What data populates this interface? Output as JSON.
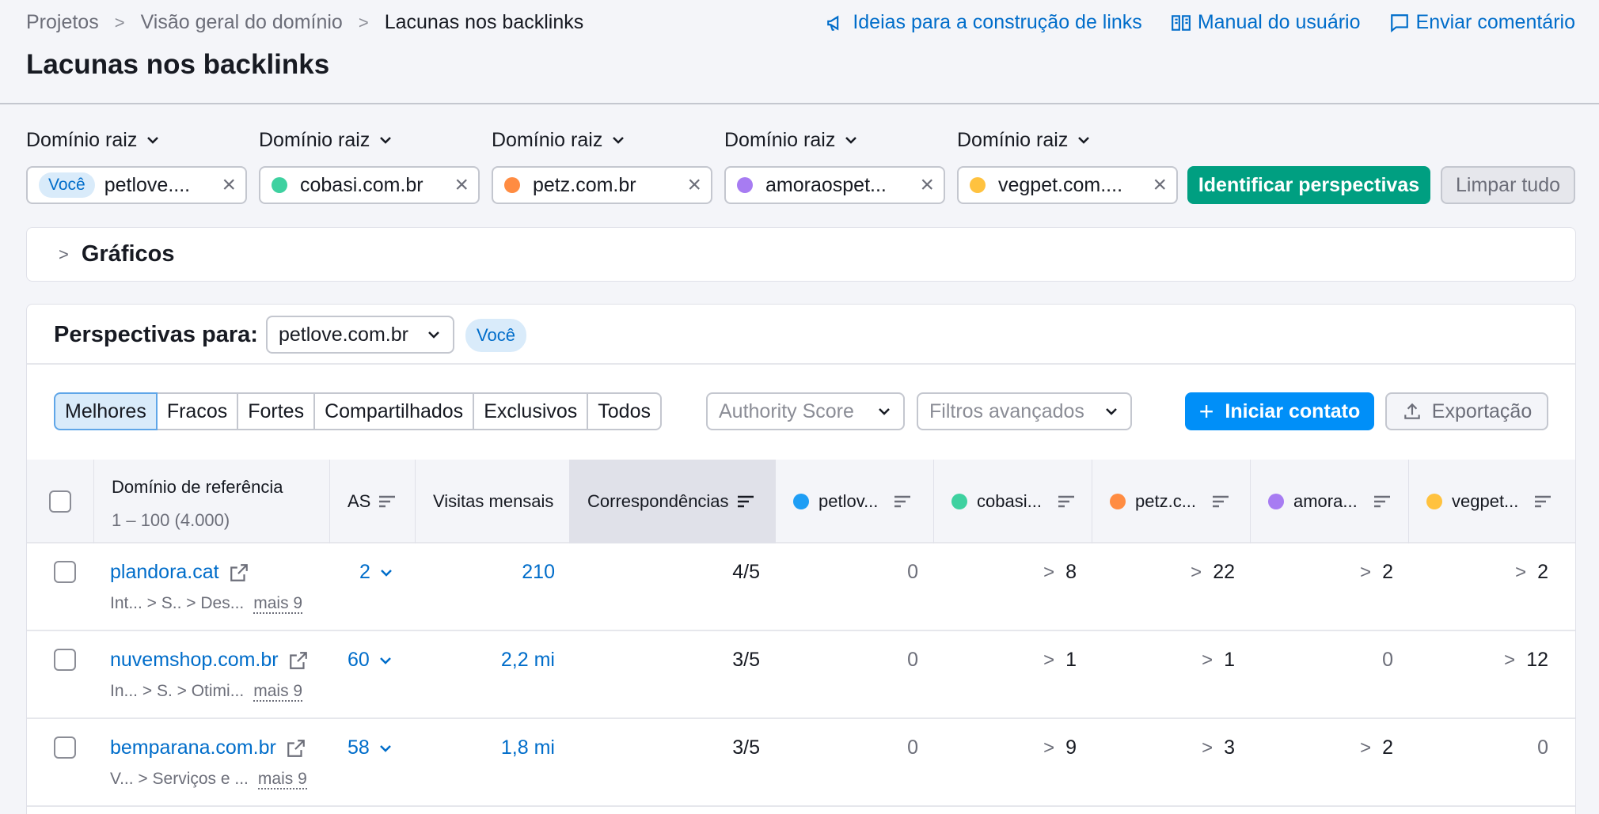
{
  "breadcrumb": [
    "Projetos",
    "Visão geral do domínio",
    "Lacunas nos backlinks"
  ],
  "top_links": [
    {
      "label": "Ideias para a construção de links",
      "icon": "megaphone-icon"
    },
    {
      "label": "Manual do usuário",
      "icon": "book-icon"
    },
    {
      "label": "Enviar comentário",
      "icon": "comment-icon"
    }
  ],
  "page_title": "Lacunas nos backlinks",
  "domain_label": "Domínio raiz",
  "domains": [
    {
      "value": "petlove....",
      "you": "Você",
      "color": ""
    },
    {
      "value": "cobasi.com.br",
      "color": "#3ed1a0"
    },
    {
      "value": "petz.com.br",
      "color": "#ff8c42"
    },
    {
      "value": "amoraospet...",
      "color": "#a77cf2"
    },
    {
      "value": "vegpet.com....",
      "color": "#ffc23f"
    }
  ],
  "identify_button": "Identificar perspectivas",
  "clear_button": "Limpar tudo",
  "charts_label": "Gráficos",
  "perspectives": {
    "label": "Perspectivas para:",
    "selected": "petlove.com.br",
    "badge": "Você"
  },
  "tabs": [
    "Melhores",
    "Fracos",
    "Fortes",
    "Compartilhados",
    "Exclusivos",
    "Todos"
  ],
  "filters": {
    "authority": "Authority Score",
    "advanced": "Filtros avançados"
  },
  "contact_button": "Iniciar contato",
  "export_button": "Exportação",
  "table": {
    "headers": {
      "domain": "Domínio de referência",
      "range": "1 – 100 (4.000)",
      "as": "AS",
      "visits": "Visitas mensais",
      "matches": "Correspondências",
      "cols": [
        {
          "label": "petlov...",
          "color": "#1e9ef5"
        },
        {
          "label": "cobasi...",
          "color": "#3ed1a0"
        },
        {
          "label": "petz.c...",
          "color": "#ff8c42"
        },
        {
          "label": "amora...",
          "color": "#a77cf2"
        },
        {
          "label": "vegpet...",
          "color": "#ffc23f"
        }
      ]
    },
    "rows": [
      {
        "domain": "plandora.cat",
        "cats": "Int...   > S.. > Des...",
        "more": "mais 9",
        "as": "2",
        "visits": "210",
        "matches": "4/5",
        "vals": [
          "0",
          "8",
          "22",
          "2",
          "2"
        ],
        "arrows": [
          false,
          true,
          true,
          true,
          true
        ]
      },
      {
        "domain": "nuvemshop.com.br",
        "cats": "In...  > S. > Otimi...",
        "more": "mais 9",
        "as": "60",
        "visits": "2,2 mi",
        "matches": "3/5",
        "vals": [
          "0",
          "1",
          "1",
          "0",
          "12"
        ],
        "arrows": [
          false,
          true,
          true,
          false,
          true
        ]
      },
      {
        "domain": "bemparana.com.br",
        "cats": "V... > Serviços e ...",
        "more": "mais 9",
        "as": "58",
        "visits": "1,8 mi",
        "matches": "3/5",
        "vals": [
          "0",
          "9",
          "3",
          "2",
          "0"
        ],
        "arrows": [
          false,
          true,
          true,
          true,
          false
        ]
      }
    ]
  }
}
